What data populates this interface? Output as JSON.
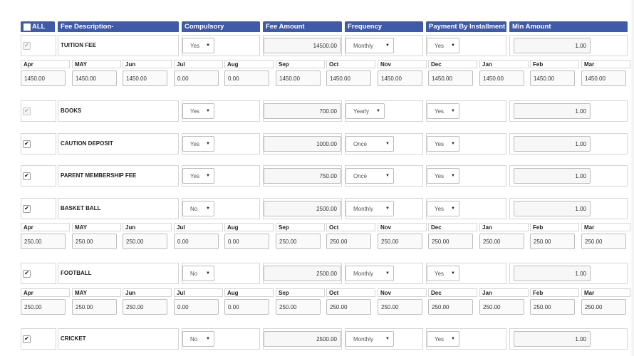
{
  "headers": {
    "all": "ALL",
    "fee_description": "Fee Description-",
    "compulsory": "Compulsory",
    "fee_amount": "Fee Amount",
    "frequency": "Frequency",
    "payment_by_installment": "Payment By Installment",
    "min_amount": "Min Amount"
  },
  "months": [
    "Apr",
    "MAY",
    "Jun",
    "Jul",
    "Aug",
    "Sep",
    "Oct",
    "Nov",
    "Dec",
    "Jan",
    "Feb",
    "Mar"
  ],
  "fees": [
    {
      "checked": true,
      "disabled": true,
      "name": "TUITION FEE",
      "compulsory": "Yes",
      "amount": "14500.00",
      "frequency": "Monthly",
      "installment": "Yes",
      "min_amount": "1.00",
      "months": [
        "1450.00",
        "1450.00",
        "1450.00",
        "0.00",
        "0.00",
        "1450.00",
        "1450.00",
        "1450.00",
        "1450.00",
        "1450.00",
        "1450.00",
        "1450.00"
      ]
    },
    {
      "checked": true,
      "disabled": true,
      "name": "BOOKS",
      "compulsory": "Yes",
      "amount": "700.00",
      "frequency": "Yearly",
      "installment": "Yes",
      "min_amount": "1.00",
      "months": null
    },
    {
      "checked": true,
      "disabled": false,
      "name": "CAUTION DEPOSIT",
      "compulsory": "Yes",
      "amount": "1000.00",
      "frequency": "Once",
      "installment": "Yes",
      "min_amount": "1.00",
      "months": null
    },
    {
      "checked": true,
      "disabled": false,
      "name": "PARENT MEMBERSHIP FEE",
      "compulsory": "Yes",
      "amount": "750.00",
      "frequency": "Once",
      "installment": "Yes",
      "min_amount": "1.00",
      "months": null
    },
    {
      "checked": true,
      "disabled": false,
      "name": "BASKET BALL",
      "compulsory": "No",
      "amount": "2500.00",
      "frequency": "Monthly",
      "installment": "Yes",
      "min_amount": "1.00",
      "months": [
        "250.00",
        "250.00",
        "250.00",
        "0.00",
        "0.00",
        "250.00",
        "250.00",
        "250.00",
        "250.00",
        "250.00",
        "250.00",
        "250.00"
      ]
    },
    {
      "checked": true,
      "disabled": false,
      "name": "FOOTBALL",
      "compulsory": "No",
      "amount": "2500.00",
      "frequency": "Monthly",
      "installment": "Yes",
      "min_amount": "1.00",
      "months": [
        "250.00",
        "250.00",
        "250.00",
        "0.00",
        "0.00",
        "250.00",
        "250.00",
        "250.00",
        "250.00",
        "250.00",
        "250.00",
        "250.00"
      ]
    },
    {
      "checked": true,
      "disabled": false,
      "name": "CRICKET",
      "compulsory": "No",
      "amount": "2500.00",
      "frequency": "Monthly",
      "installment": "Yes",
      "min_amount": "1.00",
      "months": null
    }
  ],
  "icons": {
    "dropdown": "triangle-down",
    "checkbox": "check-mark"
  },
  "colors": {
    "header_bg": "#3e5aa8",
    "header_text": "#ffffff"
  }
}
